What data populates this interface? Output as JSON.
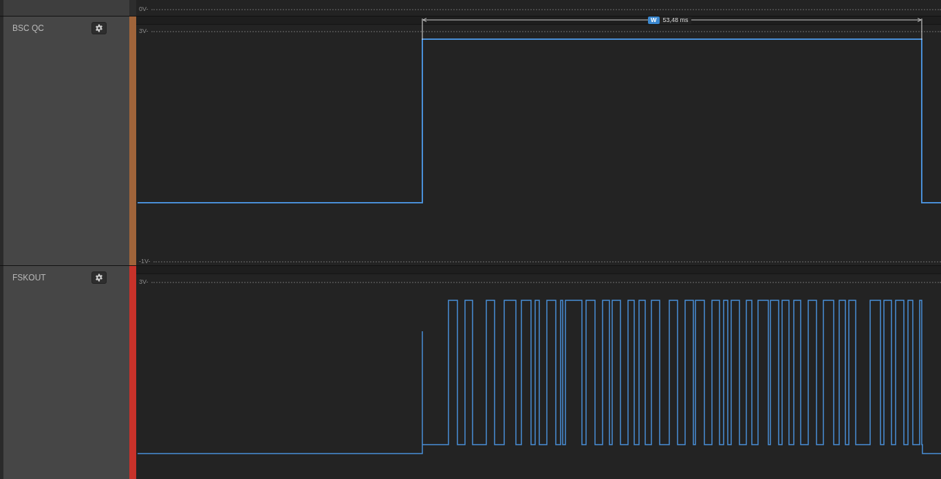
{
  "top_channel": {
    "axis_label": "0V-"
  },
  "channels": [
    {
      "name": "BSC QC",
      "color": "#a0643a",
      "axis_labels": [
        "3V-",
        "-1V-"
      ],
      "kind": "gate"
    },
    {
      "name": "FSKOUT",
      "color": "#c8322a",
      "axis_labels": [
        "3V-"
      ],
      "kind": "pulses"
    }
  ],
  "measurement": {
    "badge": "W",
    "value": "53,48 ms"
  }
}
